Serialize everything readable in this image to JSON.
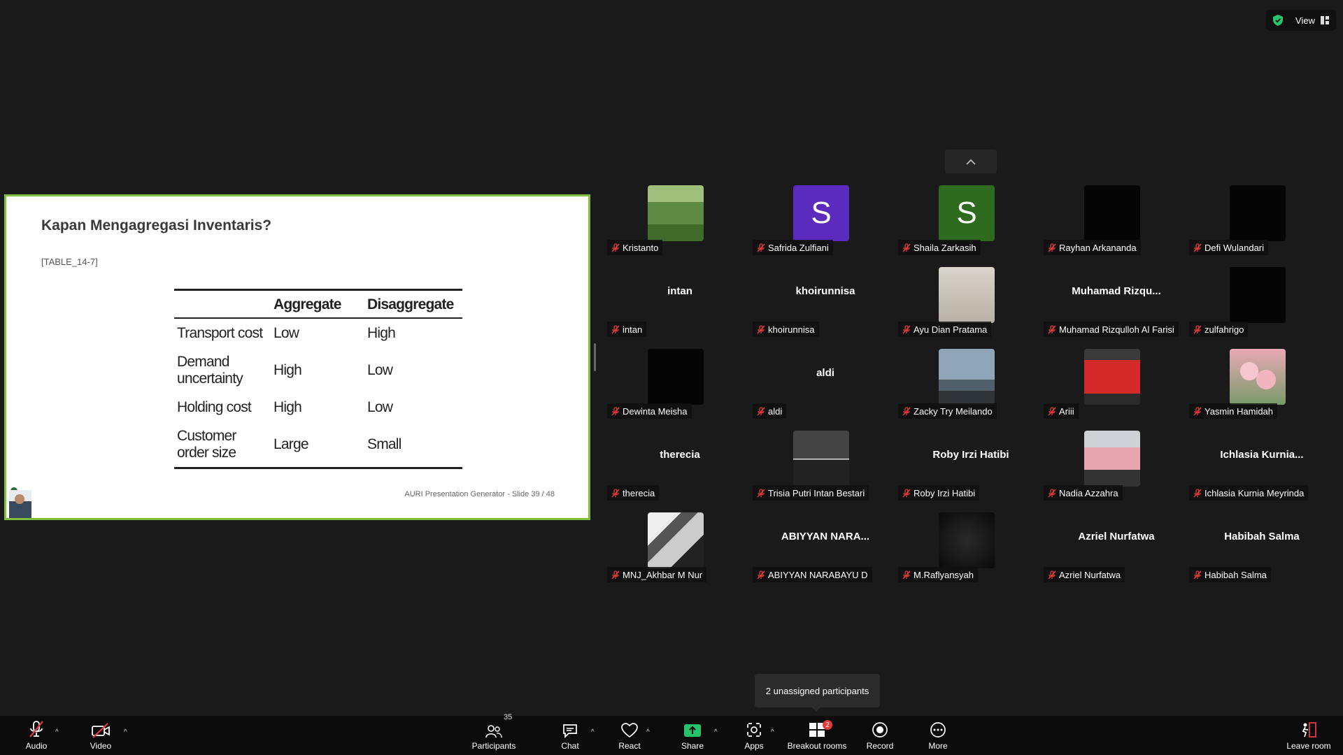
{
  "window": {
    "view_label": "View"
  },
  "slide": {
    "title": "Kapan Mengagregasi Inventaris?",
    "subtitle": "[TABLE_14-7]",
    "footer": "AURI Presentation Generator - Slide 39 / 48",
    "table": {
      "headers": [
        "",
        "Aggregate",
        "Disaggregate"
      ],
      "rows": [
        [
          "Transport cost",
          "Low",
          "High"
        ],
        [
          "Demand uncertainty",
          "High",
          "Low"
        ],
        [
          "Holding cost",
          "High",
          "Low"
        ],
        [
          "Customer order size",
          "Large",
          "Small"
        ]
      ]
    }
  },
  "participants": [
    {
      "name": "Kristanto",
      "avatar": "photo-hiker"
    },
    {
      "name": "Safrida Zulfiani",
      "avatar": "S",
      "color": "#5b2bbd"
    },
    {
      "name": "Shaila Zarkasih",
      "avatar": "S",
      "color": "#2f6b1e"
    },
    {
      "name": "Rayhan Arkananda",
      "avatar": "black"
    },
    {
      "name": "Defi Wulandari",
      "avatar": "black"
    },
    {
      "name": "intan",
      "big": "intan"
    },
    {
      "name": "khoirunnisa",
      "big": "khoirunnisa"
    },
    {
      "name": "Ayu Dian Pratama",
      "avatar": "photo-dancer"
    },
    {
      "name": "Muhamad Rizqulloh Al Farisi",
      "big": "Muhamad  Rizqu..."
    },
    {
      "name": "zulfahrigo",
      "avatar": "black"
    },
    {
      "name": "Dewinta Meisha",
      "avatar": "black"
    },
    {
      "name": "aldi",
      "big": "aldi"
    },
    {
      "name": "Zacky Try Meilando",
      "avatar": "photo-sky"
    },
    {
      "name": "Ariii",
      "avatar": "photo-kid"
    },
    {
      "name": "Yasmin Hamidah",
      "avatar": "photo-roses"
    },
    {
      "name": "therecia",
      "big": "therecia"
    },
    {
      "name": "Trisia Putri Intan Bestari",
      "avatar": "photo-grey"
    },
    {
      "name": "Roby Irzi Hatibi",
      "big": "Roby Irzi Hatibi"
    },
    {
      "name": "Nadia Azzahra",
      "avatar": "photo-girl"
    },
    {
      "name": "Ichlasia Kurnia Meyrinda",
      "big": "Ichlasia  Kurnia..."
    },
    {
      "name": "MNJ_Akhbar M Nur",
      "avatar": "photo-desk"
    },
    {
      "name": "ABIYYAN NARABAYU D",
      "big": "ABIYYAN NARA..."
    },
    {
      "name": "M.Raflyansyah",
      "avatar": "photo-dark"
    },
    {
      "name": "Azriel Nurfatwa",
      "big": "Azriel Nurfatwa"
    },
    {
      "name": "Habibah Salma",
      "big": "Habibah Salma"
    }
  ],
  "tooltip": "2 unassigned participants",
  "toolbar": {
    "audio": "Audio",
    "video": "Video",
    "participants": "Participants",
    "participants_count": "35",
    "chat": "Chat",
    "react": "React",
    "share": "Share",
    "apps": "Apps",
    "breakout": "Breakout rooms",
    "breakout_badge": "2",
    "record": "Record",
    "more": "More",
    "leave": "Leave room"
  },
  "colors": {
    "accent_green": "#24c46a",
    "slide_border": "#7fbf3f",
    "badge_red": "#e43a3a"
  }
}
